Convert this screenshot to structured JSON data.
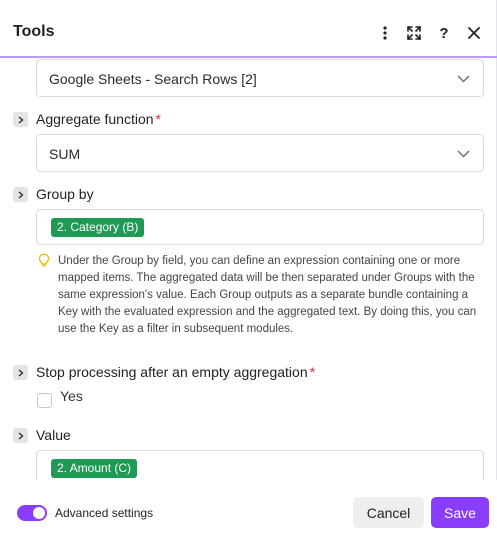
{
  "panel": {
    "title": "Tools",
    "icons": [
      "more-vertical-icon",
      "expand-icon",
      "help-icon",
      "close-icon"
    ],
    "help_glyph": "?"
  },
  "module_select": {
    "value": "Google Sheets - Search Rows [2]"
  },
  "aggregate_function": {
    "label": "Aggregate function",
    "required_mark": "*",
    "value": "SUM"
  },
  "group_by": {
    "label": "Group by",
    "tag": "2. Category (B)",
    "hint": "Under the Group by field, you can define an expression containing one or more mapped items. The aggregated data will be then separated under Groups with the same expression's value. Each Group outputs as a separate bundle containing a Key with the evaluated expression and the aggregated text. By doing this, you can use the Key as a filter in subsequent modules."
  },
  "stop_processing": {
    "label": "Stop processing after an empty aggregation",
    "required_mark": "*",
    "option_label": "Yes",
    "checked": false
  },
  "value_field": {
    "label": "Value",
    "tag": "2. Amount (C)"
  },
  "footer": {
    "advanced_label": "Advanced settings",
    "advanced_enabled": true,
    "cancel_label": "Cancel",
    "save_label": "Save"
  },
  "colors": {
    "accent": "#8b3dff",
    "tag_green": "#1f9a54",
    "required_red": "#e02d3c",
    "hint_yellow": "#f2c200"
  }
}
